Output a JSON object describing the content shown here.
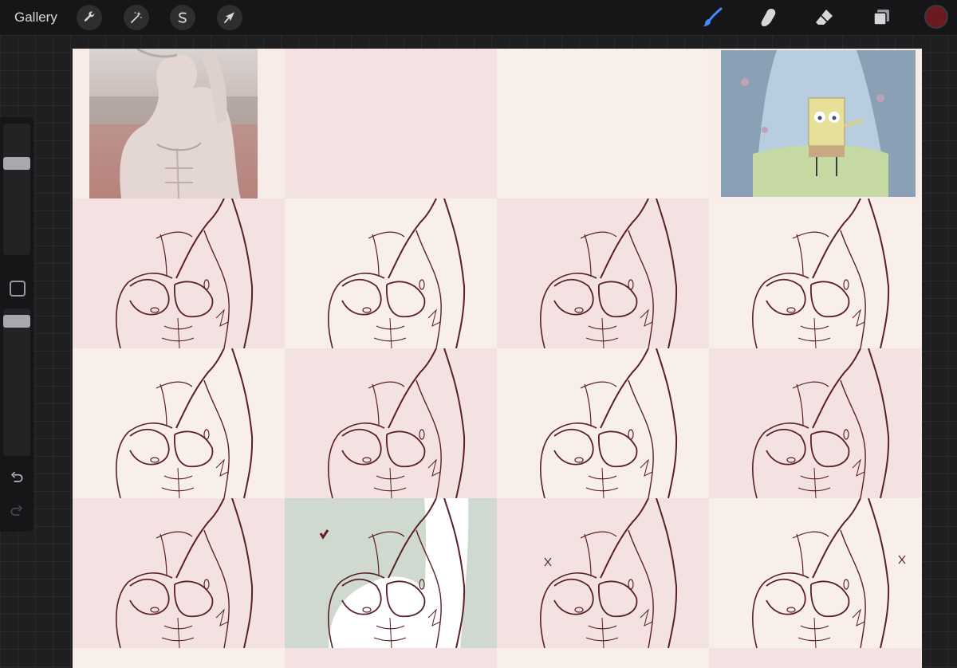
{
  "toolbar": {
    "gallery_label": "Gallery",
    "left_tools": [
      {
        "name": "actions",
        "icon": "wrench-icon"
      },
      {
        "name": "adjustments",
        "icon": "magic-wand-icon"
      },
      {
        "name": "selection",
        "icon": "selection-s-icon"
      },
      {
        "name": "transform",
        "icon": "arrow-cursor-icon"
      }
    ],
    "right_tools": [
      {
        "name": "brush",
        "icon": "brush-icon",
        "active": true
      },
      {
        "name": "smudge",
        "icon": "smudge-finger-icon",
        "active": false
      },
      {
        "name": "eraser",
        "icon": "eraser-icon",
        "active": false
      },
      {
        "name": "layers",
        "icon": "layers-icon",
        "active": false
      }
    ],
    "current_color": "#6b1a22",
    "active_tool_color": "#3f8cff"
  },
  "sidebar": {
    "brush_size_level": 0.72,
    "opacity_level": 0.95,
    "undo_icon": "undo-arrow-icon",
    "redo_icon": "redo-arrow-icon",
    "modify_icon": "square-modify-icon"
  },
  "canvas": {
    "background": "#f7ece7",
    "cell_colors": {
      "pink": "#f4e2e2",
      "cream": "#f8efe9",
      "green": "#cfd9cf"
    },
    "line_color": "#5b2027",
    "references": [
      {
        "name": "male-torso-photo-reference",
        "icon": "photo-icon"
      },
      {
        "name": "cartoon-sponge-reference",
        "icon": "cartoon-image-icon"
      }
    ],
    "marks": {
      "checkmark": "heart-check-icon",
      "cross": "x-mark-icon"
    }
  }
}
